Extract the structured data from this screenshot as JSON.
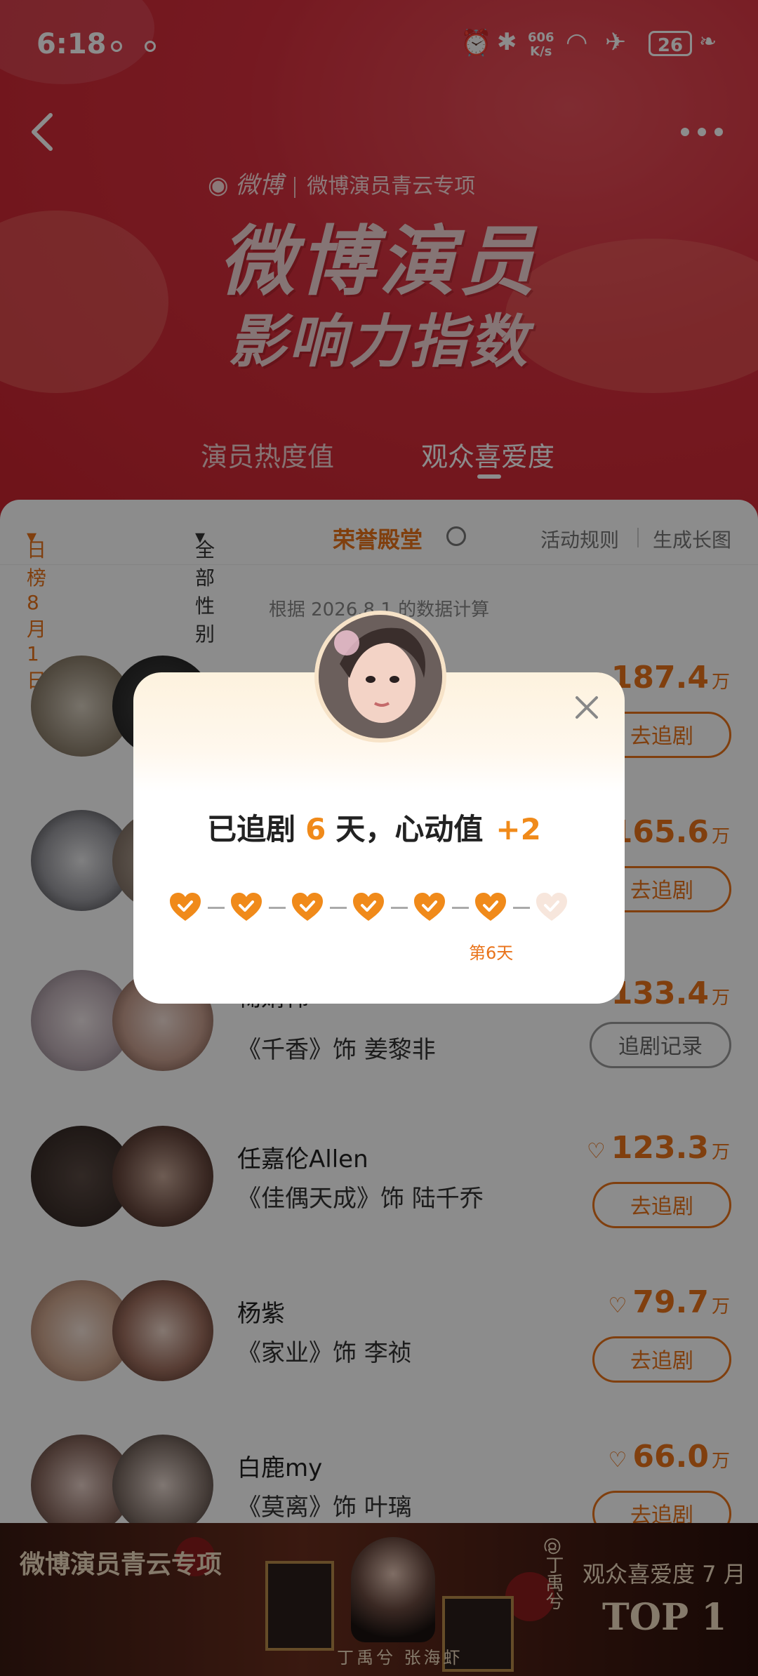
{
  "status": {
    "time": "6:18",
    "speed_top": "606",
    "speed_bottom": "K/s",
    "battery": "26"
  },
  "header": {
    "brand": "微博",
    "subbrand": "微博演员青云专项",
    "title_line1": "微博演员",
    "title_line2": "影响力指数",
    "tabs": [
      {
        "label": "演员热度值"
      },
      {
        "label": "观众喜爱度"
      }
    ]
  },
  "filters": {
    "date": "日榜 8月1日",
    "gender": "全部性别",
    "hall": "荣誉殿堂",
    "rules": "活动规则",
    "long_pic": "生成长图"
  },
  "note": "根据 2026.8.1 的数据计算",
  "rows": [
    {
      "name": "",
      "role": "",
      "score": "187.4",
      "unit": "万",
      "button": "去追剧"
    },
    {
      "name": "",
      "role": "",
      "score": "165.6",
      "unit": "万",
      "button": "去追剧"
    },
    {
      "name": "鞠婧祎",
      "role": "《千香》饰 姜黎非",
      "score": "133.4",
      "unit": "万",
      "button": "追剧记录"
    },
    {
      "name": "任嘉伦Allen",
      "role": "《佳偶天成》饰 陆千乔",
      "score": "123.3",
      "unit": "万",
      "button": "去追剧"
    },
    {
      "name": "杨紫",
      "role": "《家业》饰 李祯",
      "score": "79.7",
      "unit": "万",
      "button": "去追剧"
    },
    {
      "name": "白鹿my",
      "role": "《莫离》饰 叶璃",
      "score": "66.0",
      "unit": "万",
      "button": "去追剧"
    }
  ],
  "banner": {
    "title": "微博演员青云专项",
    "caption": "观众喜爱度 7 月",
    "rank": "TOP 1",
    "names": "丁禹兮  张海虾",
    "handle": "@丁禹兮"
  },
  "modal": {
    "prefix": "已追剧",
    "days": "6",
    "mid": "天，心动值",
    "plus": "+2",
    "day_label": "第6天",
    "hearts_done": 6,
    "hearts_total": 7
  },
  "colors": {
    "accent": "#e9731a",
    "hero_red": "#d72f3d",
    "heart": "#f08a1a",
    "heart_empty": "#f7e6dc"
  },
  "icons": [
    "back-icon",
    "more-icon",
    "search-icon",
    "close-icon",
    "heart-icon",
    "weibo-logo-icon",
    "alarm-icon",
    "bluetooth-icon",
    "wifi-icon",
    "airplane-icon"
  ]
}
